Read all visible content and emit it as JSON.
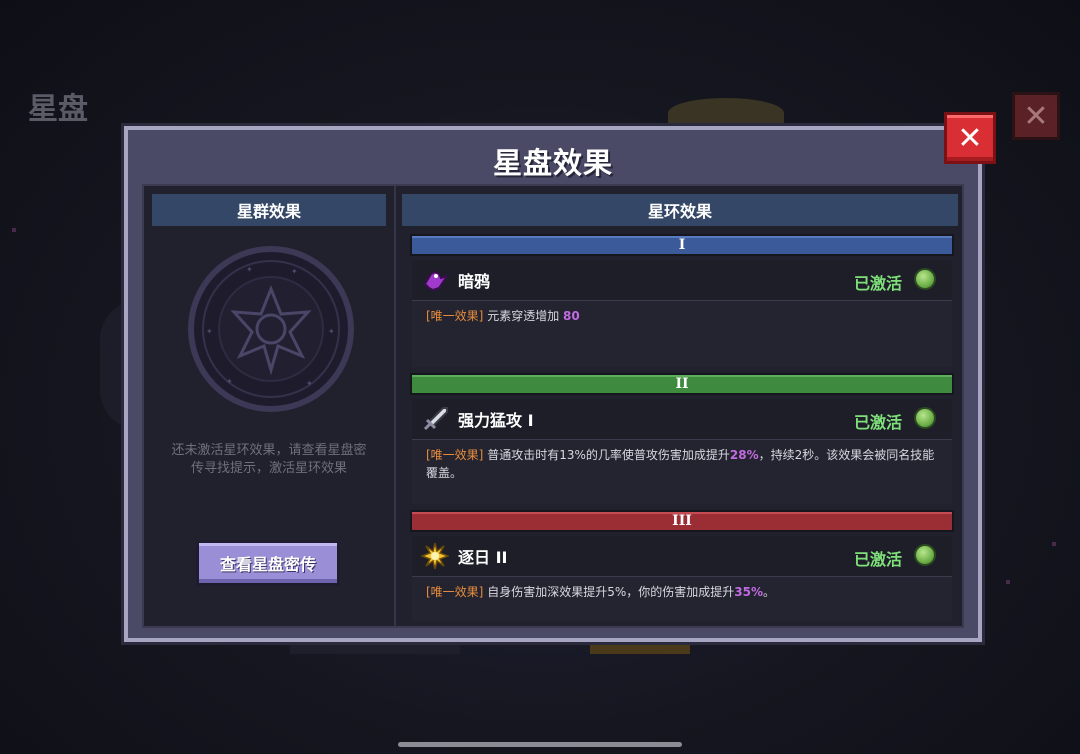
{
  "background": {
    "title": "星盘",
    "close_glyph": "✕"
  },
  "dialog": {
    "title": "星盘效果",
    "close_glyph": "✕",
    "left_panel": {
      "header": "星群效果",
      "hint_line1": "还未激活星环效果，请查看星盘密",
      "hint_line2": "传寻找提示，激活星环效果",
      "lore_button": "查看星盘密传"
    },
    "right_panel": {
      "header": "星环效果",
      "tiers": [
        {
          "numeral": "I",
          "color": "#3a5a9a",
          "skill_name": "暗鸦",
          "icon": "crow-icon",
          "status": "已激活",
          "tag": "[唯一效果]",
          "desc_a": "元素穿透增加 ",
          "highlight": "80",
          "desc_b": ""
        },
        {
          "numeral": "II",
          "color": "#3e8a3e",
          "skill_name": "强力猛攻 I",
          "icon": "sword-icon",
          "status": "已激活",
          "tag": "[唯一效果]",
          "desc_a": "普通攻击时有13%的几率使普攻伤害加成提升",
          "highlight": "28%",
          "desc_b": "，持续2秒。该效果会被同名技能覆盖。"
        },
        {
          "numeral": "III",
          "color": "#9a2e34",
          "skill_name": "逐日 II",
          "icon": "sun-icon",
          "status": "已激活",
          "tag": "[唯一效果]",
          "desc_a": "自身伤害加深效果提升5%，你的伤害加成提升",
          "highlight": "35%",
          "desc_b": "。"
        }
      ]
    }
  },
  "colors": {
    "status_active": "#7fe07a",
    "tag": "#e68b3c",
    "highlight": "#c06be0",
    "header_bg": "#344766"
  }
}
